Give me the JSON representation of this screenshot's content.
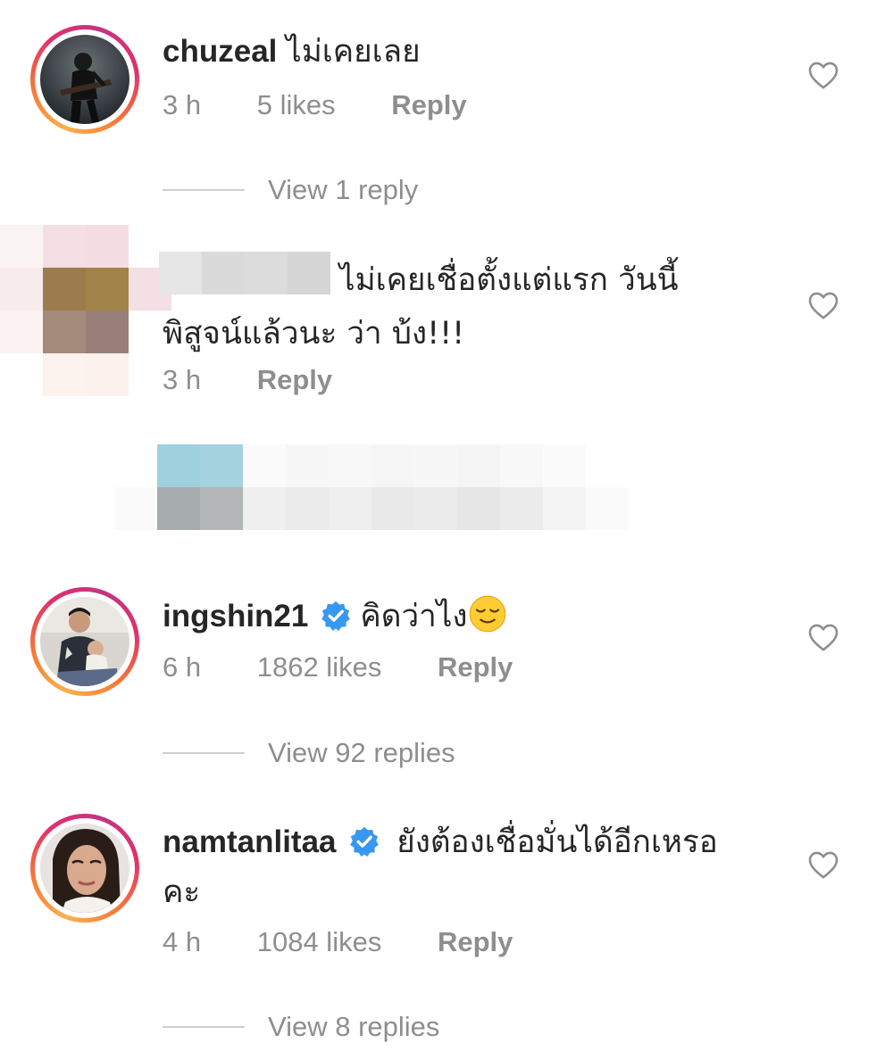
{
  "comments": [
    {
      "username": "chuzeal",
      "text": "ไม่เคยเลย",
      "time": "3 h",
      "likes": "5 likes",
      "reply_label": "Reply",
      "view_replies": "View 1 reply",
      "verified": false,
      "avatar_icon": "guitarist-photo-avatar"
    },
    {
      "username": "",
      "text_line1": "ไม่เคยเชื่อตั้งแต่แรก วันนี้",
      "text_line2": "พิสูจน์แล้วนะ ว่า บ้ง!!!",
      "time": "3 h",
      "reply_label": "Reply",
      "censored": true
    },
    {
      "username": "ingshin21",
      "text": "คิดว่าไง",
      "time": "6 h",
      "likes": "1862 likes",
      "reply_label": "Reply",
      "view_replies": "View 92 replies",
      "verified": true,
      "emoji": "relieved-face-emoji"
    },
    {
      "username": "namtanlitaa",
      "text_line1": "ยังต้องเชื่อมั่นได้อีกเหรอ",
      "text_line2": "คะ",
      "time": "4 h",
      "likes": "1084 likes",
      "reply_label": "Reply",
      "view_replies": "View 8 replies",
      "verified": true
    }
  ],
  "colors": {
    "text": "#262626",
    "meta": "#8e8e8e",
    "verified_blue": "#3897f0",
    "divider": "#cfcfcf"
  },
  "icons": {
    "like": "heart-outline-icon",
    "verified": "verified-badge-icon"
  }
}
